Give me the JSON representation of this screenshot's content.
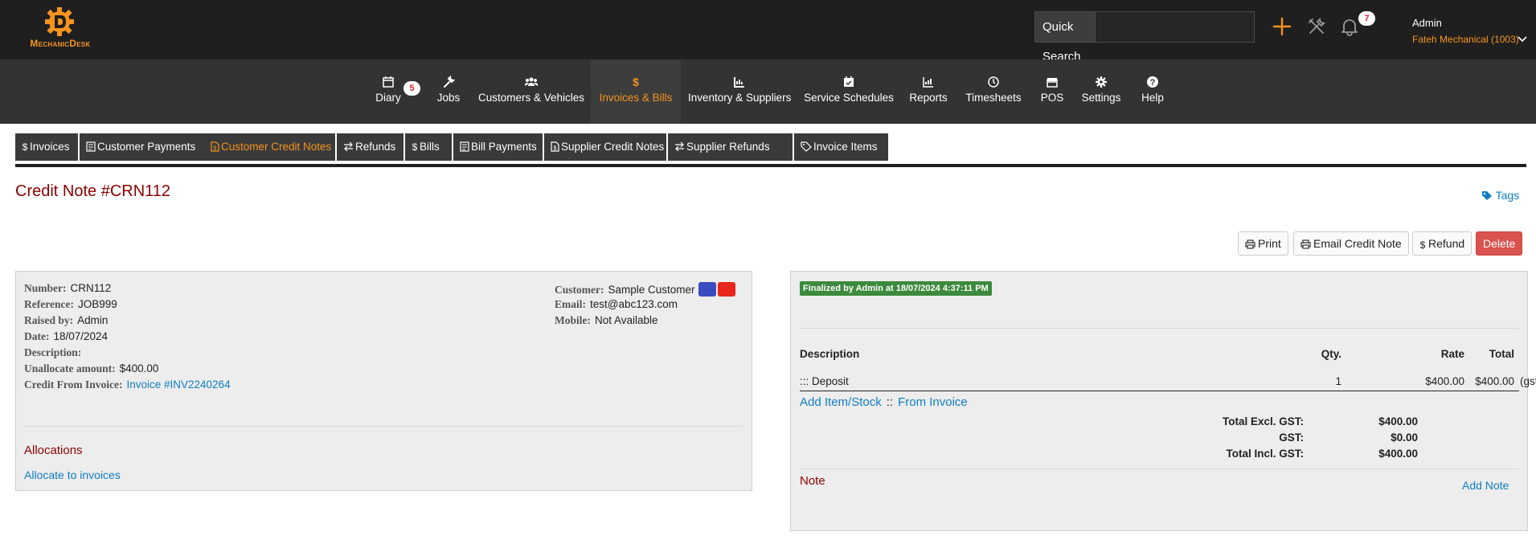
{
  "brand": {
    "name": "MechanicDesk",
    "accent": "#f7941d"
  },
  "header": {
    "quick_search_label": "Quick Search",
    "quick_search_value": "",
    "notification_count": "7",
    "user_name": "Admin",
    "company": "Fateh Mechanical (1003)"
  },
  "nav": {
    "items": [
      {
        "label": "Diary",
        "icon": "calendar-icon"
      },
      {
        "label": "Jobs",
        "icon": "wrench-icon"
      },
      {
        "label": "Customers & Vehicles",
        "icon": "users-icon"
      },
      {
        "label": "Invoices & Bills",
        "icon": "dollar-icon"
      },
      {
        "label": "Inventory & Suppliers",
        "icon": "inventory-icon"
      },
      {
        "label": "Service Schedules",
        "icon": "calendar-check-icon"
      },
      {
        "label": "Reports",
        "icon": "chart-icon"
      },
      {
        "label": "Timesheets",
        "icon": "clock-icon"
      },
      {
        "label": "POS",
        "icon": "store-icon"
      },
      {
        "label": "Settings",
        "icon": "gear-icon"
      },
      {
        "label": "Help",
        "icon": "question-icon"
      }
    ],
    "diary_badge": "5"
  },
  "subtabs": [
    {
      "label": "Invoices",
      "icon": "dollar-icon"
    },
    {
      "label": "Customer Payments",
      "icon": "receipt-icon"
    },
    {
      "label": "Customer Credit Notes",
      "icon": "file-dollar-icon"
    },
    {
      "label": "Refunds",
      "icon": "exchange-icon"
    },
    {
      "label": "Bills",
      "icon": "dollar-icon"
    },
    {
      "label": "Bill Payments",
      "icon": "receipt-icon"
    },
    {
      "label": "Supplier Credit Notes",
      "icon": "file-dollar-icon"
    },
    {
      "label": "Supplier Refunds",
      "icon": "exchange-icon"
    },
    {
      "label": "Invoice Items",
      "icon": "tags-icon"
    }
  ],
  "page": {
    "title": "Credit Note #CRN112",
    "tags_label": "Tags"
  },
  "actions": {
    "print": "Print",
    "email": "Email Credit Note",
    "refund": "Refund",
    "delete": "Delete"
  },
  "details": {
    "number_label": "Number:",
    "number": "CRN112",
    "reference_label": "Reference:",
    "reference": "JOB999",
    "raised_by_label": "Raised by:",
    "raised_by": "Admin",
    "date_label": "Date:",
    "date": "18/07/2024",
    "description_label": "Description:",
    "unallocated_label": "Unallocate amount:",
    "unallocated": "$400.00",
    "credit_from_label": "Credit From Invoice:",
    "credit_from": "Invoice #INV2240264",
    "customer_label": "Customer:",
    "customer": "Sample Customer",
    "email_label": "Email:",
    "email": "test@abc123.com",
    "mobile_label": "Mobile:",
    "mobile": "Not Available",
    "swatch_colors": [
      "#3b4cc0",
      "#e8261b"
    ]
  },
  "allocations": {
    "title": "Allocations",
    "link": "Allocate to invoices"
  },
  "credit_note": {
    "finalized": "Finalized by Admin at 18/07/2024 4:37:11 PM",
    "headers": {
      "description": "Description",
      "qty": "Qty.",
      "rate": "Rate",
      "total": "Total"
    },
    "items": [
      {
        "handle": ":::",
        "description": "Deposit",
        "qty": "1",
        "rate": "$400.00",
        "total": "$400.00",
        "tax": "(gst free)"
      }
    ],
    "add_item": "Add Item/Stock",
    "separator": "::",
    "from_invoice": "From Invoice",
    "totals": [
      {
        "label": "Total Excl. GST:",
        "value": "$400.00"
      },
      {
        "label": "GST:",
        "value": "$0.00"
      },
      {
        "label": "Total Incl. GST:",
        "value": "$400.00"
      }
    ],
    "note_title": "Note",
    "add_note": "Add Note"
  }
}
